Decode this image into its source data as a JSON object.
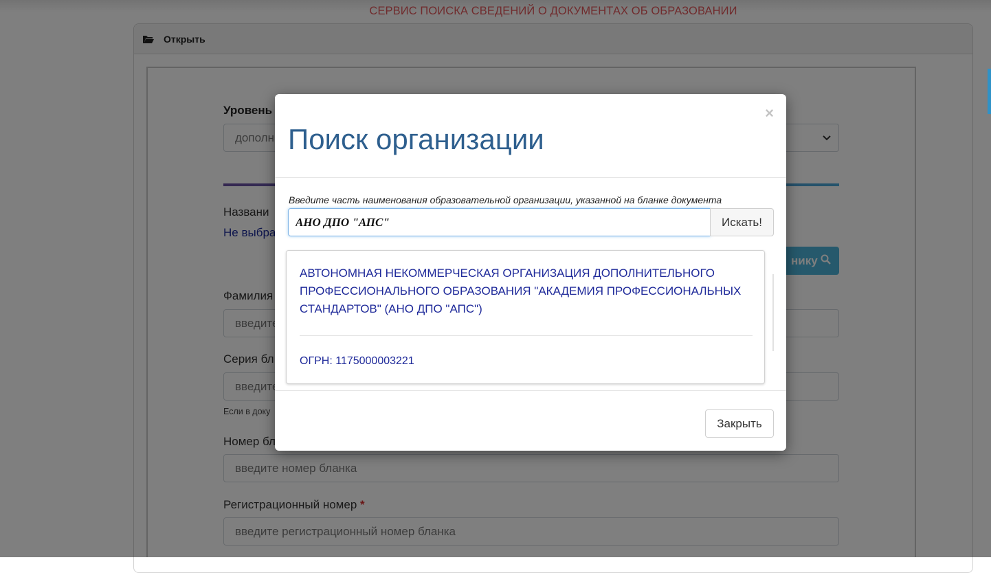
{
  "header": {
    "service_title": "СЕРВИС ПОИСКА СВЕДЕНИЙ О ДОКУМЕНТАХ ОБ ОБРАЗОВАНИИ"
  },
  "panel": {
    "open_label": "Открыть",
    "icon": "folder-open-icon"
  },
  "form": {
    "level_label": "Уровень",
    "level_value": "дополн",
    "org_label": "Названи",
    "org_value": "Не выбра",
    "find_button": "нику",
    "surname_label": "Фамилия",
    "surname_placeholder": "введите",
    "series_label": "Серия бл",
    "series_placeholder": "введите",
    "series_help": "Если в доку",
    "number_label": "Номер бл",
    "number_placeholder": "введите номер бланка",
    "reg_label": "Регистрационный номер",
    "reg_required": "*",
    "reg_placeholder": "введите регистрационный номер бланка"
  },
  "modal": {
    "title": "Поиск организации",
    "close_symbol": "×",
    "hint": "Введите часть наименования образовательной организации, указанной на бланке документа",
    "search_value": "АНО ДПО \"АПС\"",
    "search_button": "Искать!",
    "result": {
      "name": "АВТОНОМНАЯ НЕКОММЕРЧЕСКАЯ ОРГАНИЗАЦИЯ ДОПОЛНИТЕЛЬНОГО ПРОФЕССИОНАЛЬНОГО ОБРАЗОВАНИЯ \"АКАДЕМИЯ ПРОФЕССИОНАЛЬНЫХ СТАНДАРТОВ\" (АНО ДПО \"АПС\")",
      "ogrn": "ОГРН: 1175000003221"
    },
    "close_button": "Закрыть"
  },
  "colors": {
    "service_title": "#e0575a",
    "modal_title": "#2e5f8e",
    "result_text": "#1f2a9a",
    "accent_button": "#4cb3d8",
    "overlay": "rgba(0,0,0,0.5)"
  }
}
